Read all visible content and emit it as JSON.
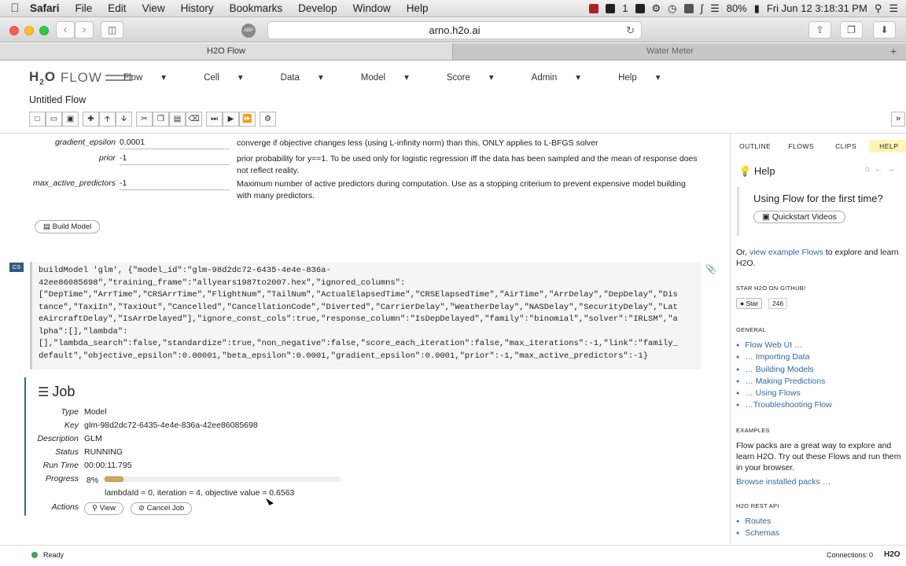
{
  "menubar": {
    "app": "Safari",
    "items": [
      "File",
      "Edit",
      "View",
      "History",
      "Bookmarks",
      "Develop",
      "Window",
      "Help"
    ],
    "battery": "80%",
    "datetime": "Fri Jun 12  3:18:31 PM",
    "extra_text": "1"
  },
  "browser": {
    "url": "arno.h2o.ai",
    "tabs": [
      "H2O Flow",
      "Water Meter"
    ],
    "abp": "ABP"
  },
  "flow": {
    "logo_text": "FLOW",
    "menus": [
      "Flow",
      "Cell",
      "Data",
      "Model",
      "Score",
      "Admin",
      "Help"
    ],
    "title": "Untitled Flow"
  },
  "params": [
    {
      "label": "gradient_epsilon",
      "value": "0.0001",
      "desc": "converge if objective changes less (using L-infinity norm) than this, ONLY applies to L-BFGS solver"
    },
    {
      "label": "prior",
      "value": "-1",
      "desc": "prior probability for y==1. To be used only for logistic regression iff the data has been sampled and the mean of response does not reflect reality."
    },
    {
      "label": "max_active_predictors",
      "value": "-1",
      "desc": "Maximum number of active predictors during computation. Use as a stopping criterium to prevent expensive model building with many predictors."
    }
  ],
  "build_button": "Build Model",
  "cell_tag": "CS",
  "code": "buildModel 'glm', {\"model_id\":\"glm-98d2dc72-6435-4e4e-836a-\n42ee86085698\",\"training_frame\":\"allyears1987to2007.hex\",\"ignored_columns\":\n[\"DepTime\",\"ArrTime\",\"CRSArrTime\",\"FlightNum\",\"TailNum\",\"ActualElapsedTime\",\"CRSElapsedTime\",\"AirTime\",\"ArrDelay\",\"DepDelay\",\"Dis\ntance\",\"TaxiIn\",\"TaxiOut\",\"Cancelled\",\"CancellationCode\",\"Diverted\",\"CarrierDelay\",\"WeatherDelay\",\"NASDelay\",\"SecurityDelay\",\"Lat\neAircraftDelay\",\"IsArrDelayed\"],\"ignore_const_cols\":true,\"response_column\":\"IsDepDelayed\",\"family\":\"binomial\",\"solver\":\"IRLSM\",\"a\nlpha\":[],\"lambda\":\n[],\"lambda_search\":false,\"standardize\":true,\"non_negative\":false,\"score_each_iteration\":false,\"max_iterations\":-1,\"link\":\"family_\ndefault\",\"objective_epsilon\":0.00001,\"beta_epsilon\":0.0001,\"gradient_epsilon\":0.0001,\"prior\":-1,\"max_active_predictors\":-1}",
  "job": {
    "title": "Job",
    "type_label": "Type",
    "type": "Model",
    "key_label": "Key",
    "key": "glm-98d2dc72-6435-4e4e-836a-42ee86085698",
    "desc_label": "Description",
    "desc": "GLM",
    "status_label": "Status",
    "status": "RUNNING",
    "runtime_label": "Run Time",
    "runtime": "00:00:11.795",
    "progress_label": "Progress",
    "progress_text": "8%",
    "progress": 0.08,
    "message": "lambdaId = 0, iteration = 4, objective value = 0.6563",
    "actions_label": "Actions",
    "view": "View",
    "cancel": "Cancel Job"
  },
  "sidebar": {
    "tabs": [
      "OUTLINE",
      "FLOWS",
      "CLIPS",
      "HELP"
    ],
    "help_title": "Help",
    "first_time": "Using Flow for the first time?",
    "quickstart": "Quickstart Videos",
    "or_text": "Or,",
    "or_link": "view example Flows",
    "or_rest": "to explore and learn H2O.",
    "star_head": "STAR H2O ON GITHUB!",
    "star": "Star",
    "star_count": "246",
    "general_head": "GENERAL",
    "general": [
      "Flow Web UI …",
      "… Importing Data",
      "… Building Models",
      "… Making Predictions",
      "… Using Flows",
      "…Troubleshooting Flow"
    ],
    "examples_head": "EXAMPLES",
    "examples_text": "Flow packs are a great way to explore and learn H2O. Try out these Flows and run them in your browser.",
    "browse": "Browse installed packs …",
    "rest_head": "H2O REST API",
    "rest": [
      "Routes",
      "Schemas"
    ]
  },
  "status": {
    "ready": "Ready",
    "connections": "Connections:",
    "conn_count": "0",
    "brand": "H2O"
  }
}
